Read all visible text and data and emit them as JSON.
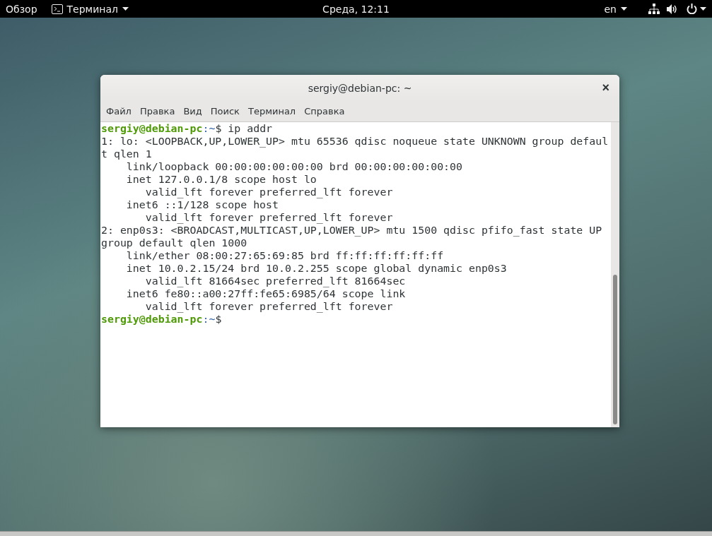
{
  "top_bar": {
    "activities": "Обзор",
    "app_menu": "Терминал",
    "clock": "Среда, 12:11",
    "language": "en"
  },
  "window": {
    "title": "sergiy@debian-pc: ~",
    "close": "×"
  },
  "menu": [
    "Файл",
    "Правка",
    "Вид",
    "Поиск",
    "Терминал",
    "Справка"
  ],
  "terminal": {
    "lines": [
      {
        "kind": "prompt",
        "user_host": "sergiy@debian-pc",
        "path": ":~",
        "command": "$ ip addr"
      },
      {
        "kind": "output",
        "text": "1: lo: <LOOPBACK,UP,LOWER_UP> mtu 65536 qdisc noqueue state UNKNOWN group defaul"
      },
      {
        "kind": "output",
        "text": "t qlen 1"
      },
      {
        "kind": "output",
        "text": "    link/loopback 00:00:00:00:00:00 brd 00:00:00:00:00:00"
      },
      {
        "kind": "output",
        "text": "    inet 127.0.0.1/8 scope host lo"
      },
      {
        "kind": "output",
        "text": "       valid_lft forever preferred_lft forever"
      },
      {
        "kind": "output",
        "text": "    inet6 ::1/128 scope host"
      },
      {
        "kind": "output",
        "text": "       valid_lft forever preferred_lft forever"
      },
      {
        "kind": "output",
        "text": "2: enp0s3: <BROADCAST,MULTICAST,UP,LOWER_UP> mtu 1500 qdisc pfifo_fast state UP"
      },
      {
        "kind": "output",
        "text": "group default qlen 1000"
      },
      {
        "kind": "output",
        "text": "    link/ether 08:00:27:65:69:85 brd ff:ff:ff:ff:ff:ff"
      },
      {
        "kind": "output",
        "text": "    inet 10.0.2.15/24 brd 10.0.2.255 scope global dynamic enp0s3"
      },
      {
        "kind": "output",
        "text": "       valid_lft 81664sec preferred_lft 81664sec"
      },
      {
        "kind": "output",
        "text": "    inet6 fe80::a00:27ff:fe65:6985/64 scope link"
      },
      {
        "kind": "output",
        "text": "       valid_lft forever preferred_lft forever"
      },
      {
        "kind": "prompt",
        "user_host": "sergiy@debian-pc",
        "path": ":~",
        "command": "$"
      }
    ]
  }
}
